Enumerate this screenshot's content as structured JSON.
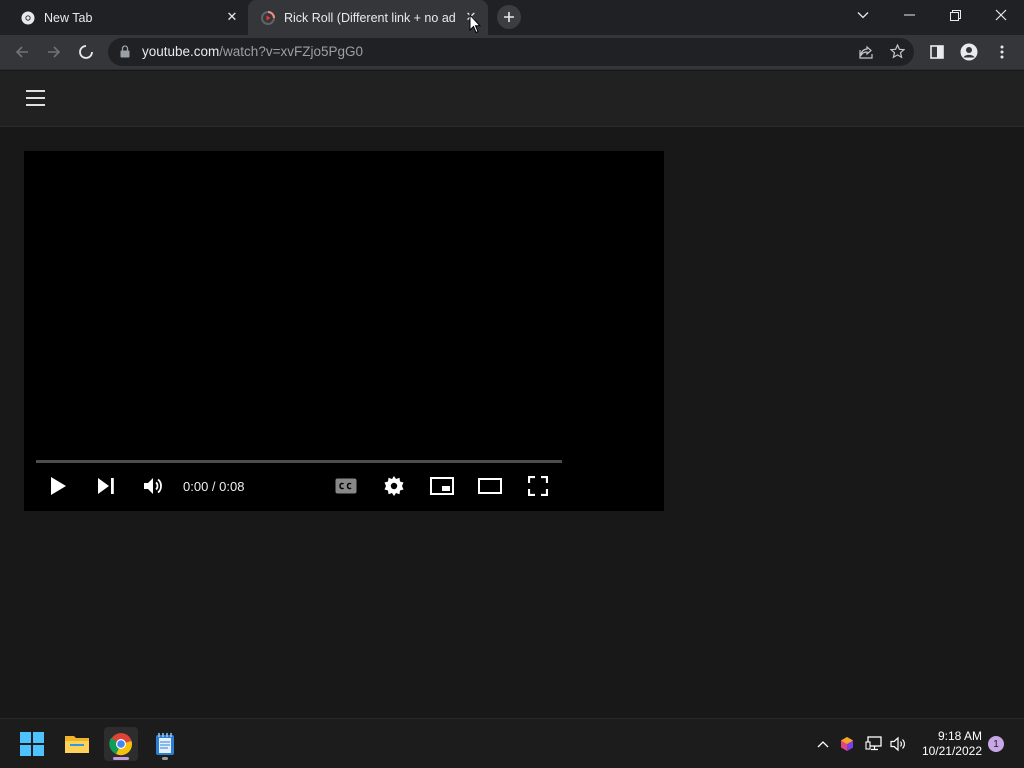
{
  "browser": {
    "tabs": [
      {
        "title": "New Tab",
        "active": false
      },
      {
        "title": "Rick Roll (Different link + no ads)",
        "active": true
      }
    ],
    "address": {
      "host": "youtube.com",
      "path": "/watch?v=xvFZjo5PgG0"
    }
  },
  "player": {
    "time_current": "0:00",
    "time_separator": " / ",
    "time_total": "0:08",
    "progress": 0
  },
  "taskbar": {
    "apps": [
      "start",
      "file-explorer",
      "chrome",
      "notepad"
    ],
    "clock_time": "9:18 AM",
    "clock_date": "10/21/2022",
    "notification_count": "1"
  },
  "colors": {
    "page_bg": "#181818",
    "masthead_bg": "#212121",
    "tab_strip_bg": "#202124",
    "active_tab_bg": "#35363a"
  }
}
